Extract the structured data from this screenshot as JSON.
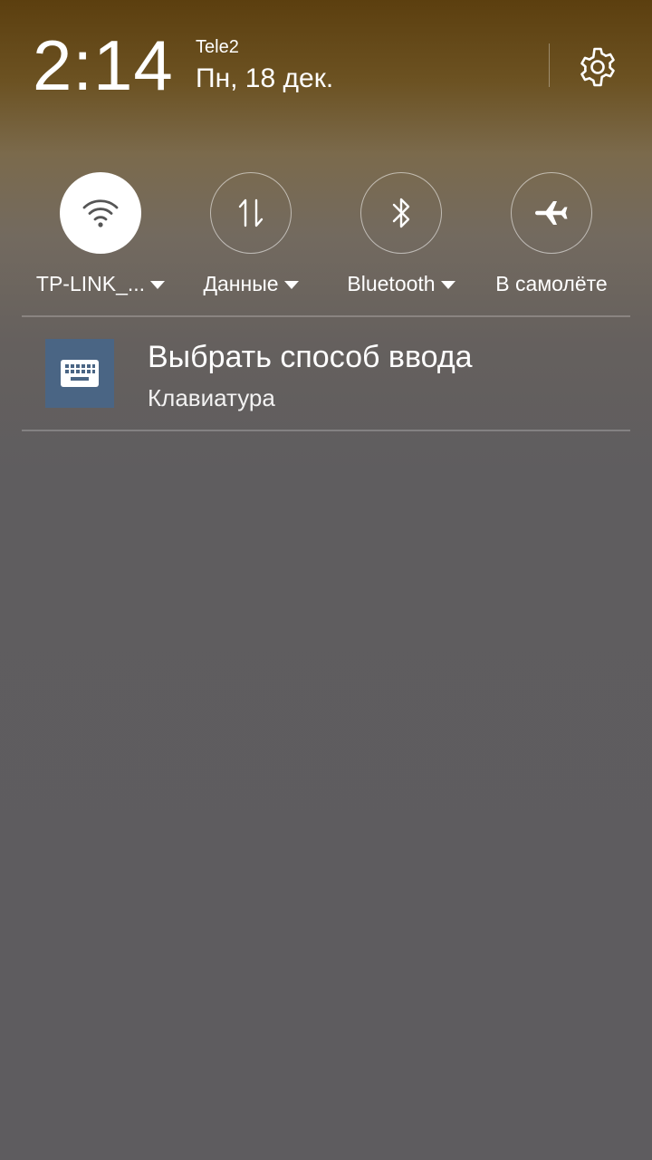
{
  "status": {
    "time": "2:14",
    "carrier": "Tele2",
    "date": "Пн, 18 дек."
  },
  "quick_settings": [
    {
      "label": "TP-LINK_...",
      "icon": "wifi-icon",
      "active": true,
      "has_dropdown": true
    },
    {
      "label": "Данные",
      "icon": "mobile-data-icon",
      "active": false,
      "has_dropdown": true
    },
    {
      "label": "Bluetooth",
      "icon": "bluetooth-icon",
      "active": false,
      "has_dropdown": true
    },
    {
      "label": "В самолёте",
      "icon": "airplane-icon",
      "active": false,
      "has_dropdown": false
    }
  ],
  "notification": {
    "title": "Выбрать способ ввода",
    "subtitle": "Клавиатура",
    "icon": "keyboard-icon",
    "icon_bg": "#4a6584"
  },
  "colors": {
    "header_top": "#5c3f0f",
    "background": "#5e5c5f"
  }
}
